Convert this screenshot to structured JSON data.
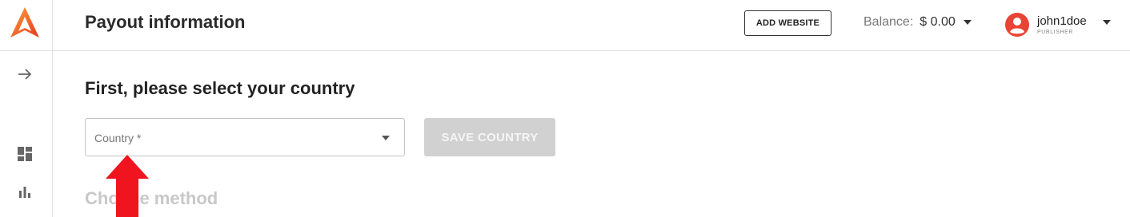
{
  "header": {
    "title": "Payout information",
    "add_website_label": "ADD WEBSITE",
    "balance_label": "Balance:",
    "balance_value": "$ 0.00",
    "user": {
      "name": "john1doe",
      "role": "PUBLISHER"
    }
  },
  "main": {
    "section_title": "First, please select your country",
    "country_select": {
      "placeholder": "Country *"
    },
    "save_country_label": "SAVE COUNTRY",
    "method_title": "Choose method"
  },
  "icons": {
    "logo": "brand-logo",
    "expand": "arrow-right-icon",
    "dashboard": "dashboard-icon",
    "stats": "bar-chart-icon",
    "avatar": "account-circle-icon",
    "caret": "caret-down-icon",
    "annotation": "red-arrow-up-icon"
  },
  "colors": {
    "logo_red": "#e53a1e",
    "logo_orange": "#ff9f3b",
    "avatar_red": "#e94335",
    "annotation_red": "#f0141e",
    "disabled_button": "#d1d1d1"
  }
}
